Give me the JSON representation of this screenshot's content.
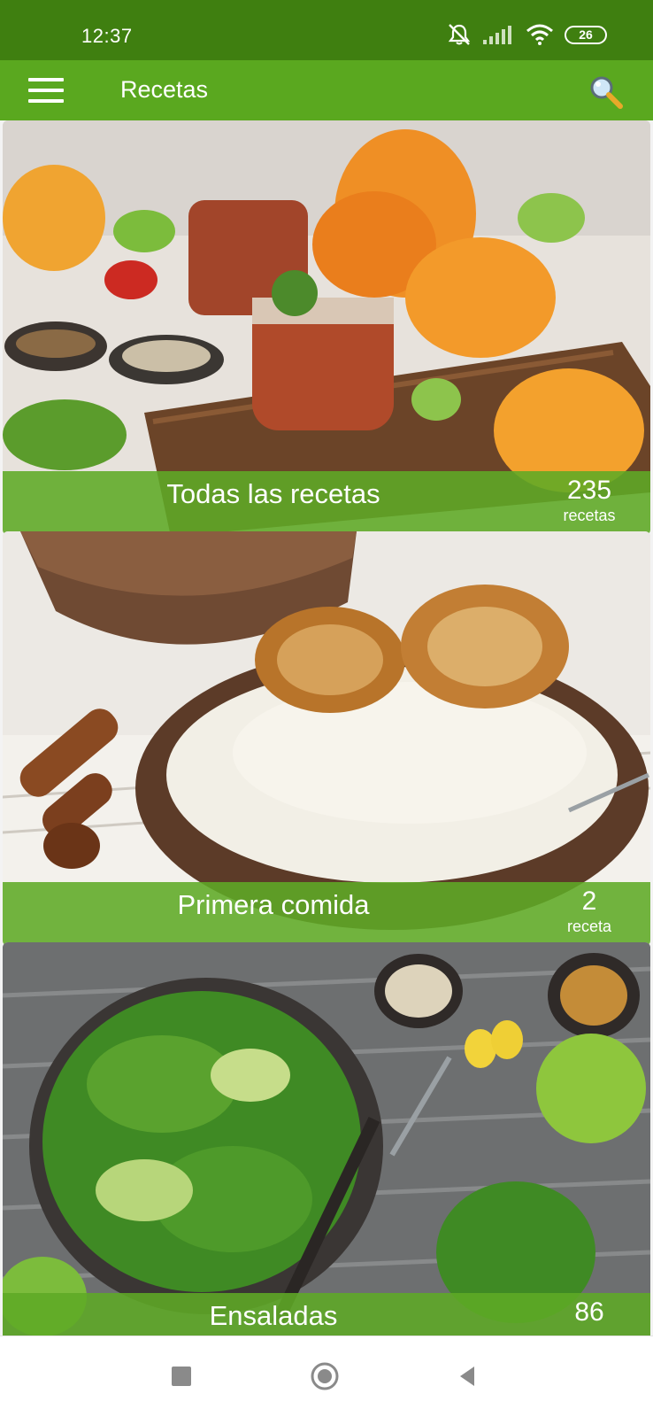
{
  "status_bar": {
    "time": "12:37",
    "icons": [
      "mute-icon",
      "signal-icon",
      "wifi-icon"
    ],
    "battery": "26"
  },
  "app_bar": {
    "title": "Recetas",
    "menu_icon": "hamburger-icon",
    "search_icon": "search-icon"
  },
  "categories": [
    {
      "title": "Todas las recetas",
      "count": "235",
      "unit": "recetas",
      "image": "pumpkin-chutney-photo"
    },
    {
      "title": "Primera comida",
      "count": "2",
      "unit": "receta",
      "image": "cream-soup-photo"
    },
    {
      "title": "Ensaladas",
      "count": "86",
      "unit": "",
      "image": "green-salad-photo"
    }
  ],
  "nav_bar": {
    "buttons": [
      "recents-icon",
      "home-icon",
      "back-icon"
    ]
  },
  "colors": {
    "status_bar": "#3f7f10",
    "app_bar": "#5aa81f",
    "card_bar": "#5eaa26"
  }
}
